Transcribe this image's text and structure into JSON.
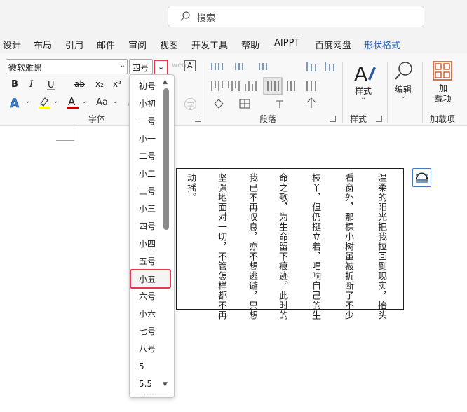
{
  "search": {
    "placeholder": "搜索",
    "icon": "search-icon"
  },
  "menu": {
    "items": [
      "设计",
      "布局",
      "引用",
      "邮件",
      "审阅",
      "视图",
      "开发工具",
      "帮助",
      "AIPPT",
      "百度网盘",
      "形状格式"
    ],
    "active": "形状格式"
  },
  "ribbon": {
    "font_name": "微软雅黑",
    "font_size": "四号",
    "bold": "B",
    "italic": "I",
    "strike": "ab",
    "subscript": "x₂",
    "superscript": "x²",
    "font_color_letter": "A",
    "char_shading": "Aa",
    "groups": {
      "font": "字体",
      "paragraph": "段落",
      "styles": "样式",
      "addins": "加载项"
    },
    "style_button": "样式",
    "edit_button": "编辑",
    "addin_button": "加\n载项",
    "accent_color": "#185abd",
    "highlight_color": "#ffff00",
    "font_color": "#c00000"
  },
  "size_list": {
    "items": [
      "初号",
      "小初",
      "一号",
      "小一",
      "二号",
      "小二",
      "三号",
      "小三",
      "四号",
      "小四",
      "五号",
      "小五",
      "六号",
      "小六",
      "七号",
      "八号",
      "5",
      "5.5"
    ],
    "selected": "小五",
    "scroll_fraction": 0.42
  },
  "document": {
    "columns": [
      "温柔的阳光把我拉回到现实，抬头",
      "看窗外，那棵小树虽被折断了不少",
      "枝丫，但仍挺立着，唱响自己的生",
      "命之歌，为生命留下痕迹。此时的",
      "我已不再叹息，亦不想逃避，只想",
      "坚强地面对一切，不管怎样都不再",
      "动摇。"
    ]
  }
}
